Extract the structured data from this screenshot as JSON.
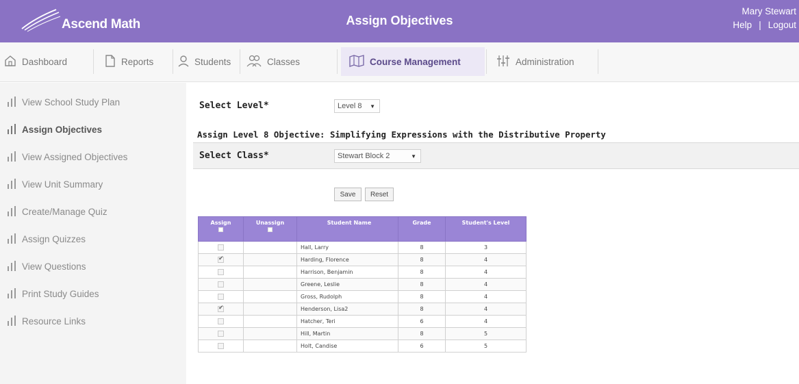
{
  "header": {
    "app_name": "Ascend Math",
    "page_title": "Assign Objectives",
    "user_name": "Mary Stewart",
    "help_label": "Help",
    "separator": "|",
    "logout_label": "Logout",
    "color": "#8a72c4"
  },
  "nav": {
    "items": [
      {
        "label": "Dashboard",
        "icon": "home-icon"
      },
      {
        "label": "Reports",
        "icon": "document-icon"
      },
      {
        "label": "Students",
        "icon": "user-icon"
      },
      {
        "label": "Classes",
        "icon": "group-icon"
      },
      {
        "label": "Course Management",
        "icon": "map-icon",
        "active": true
      },
      {
        "label": "Administration",
        "icon": "sliders-icon"
      }
    ]
  },
  "sidebar": {
    "items": [
      {
        "label": "View School Study Plan"
      },
      {
        "label": "Assign Objectives",
        "active": true
      },
      {
        "label": "View Assigned Objectives"
      },
      {
        "label": "View Unit Summary"
      },
      {
        "label": "Create/Manage Quiz"
      },
      {
        "label": "Assign Quizzes"
      },
      {
        "label": "View Questions"
      },
      {
        "label": "Print Study Guides"
      },
      {
        "label": "Resource Links"
      }
    ]
  },
  "main": {
    "level_label": "Select Level*",
    "level_value": "Level 8",
    "assign_title": "Assign Level 8 Objective: Simplifying Expressions with the Distributive Property",
    "class_label": "Select Class*",
    "class_value": "Stewart Block 2",
    "save_label": "Save",
    "reset_label": "Reset"
  },
  "table": {
    "headers": {
      "assign": "Assign",
      "unassign": "Unassign",
      "name": "Student Name",
      "grade": "Grade",
      "level": "Student's Level"
    },
    "rows": [
      {
        "checked": false,
        "name": "Hall, Larry",
        "grade": "8",
        "level": "3"
      },
      {
        "checked": true,
        "name": "Harding, Florence",
        "grade": "8",
        "level": "4"
      },
      {
        "checked": false,
        "name": "Harrison, Benjamin",
        "grade": "8",
        "level": "4"
      },
      {
        "checked": false,
        "name": "Greene, Leslie",
        "grade": "8",
        "level": "4"
      },
      {
        "checked": false,
        "name": "Gross, Rudolph",
        "grade": "8",
        "level": "4"
      },
      {
        "checked": true,
        "name": "Henderson, Lisa2",
        "grade": "8",
        "level": "4"
      },
      {
        "checked": false,
        "name": "Hatcher, Teri",
        "grade": "6",
        "level": "4"
      },
      {
        "checked": false,
        "name": "Hill, Martin",
        "grade": "8",
        "level": "5"
      },
      {
        "checked": false,
        "name": "Holt, Candise",
        "grade": "6",
        "level": "5"
      }
    ]
  }
}
